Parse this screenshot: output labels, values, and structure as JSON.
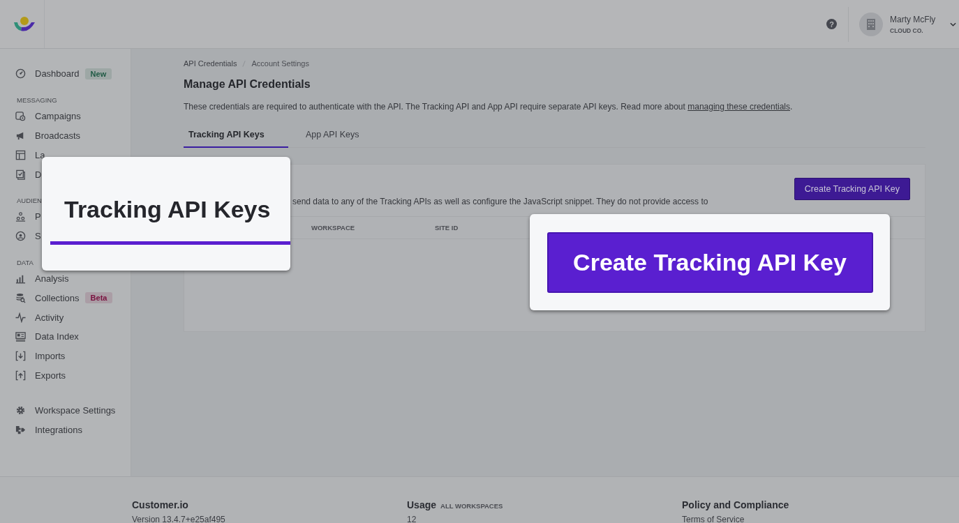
{
  "header": {
    "user_name": "Marty McFly",
    "company": "CLOUD CO.",
    "help": "?"
  },
  "sidebar": {
    "groups": [
      {
        "items": [
          {
            "label": "Dashboard",
            "badge": {
              "text": "New",
              "color": "#1f5a44"
            }
          }
        ]
      },
      {
        "heading": "MESSAGING",
        "items": [
          {
            "label": "Campaigns"
          },
          {
            "label": "Broadcasts"
          },
          {
            "label": "La"
          },
          {
            "label": "D"
          }
        ]
      },
      {
        "heading": "AUDIEN",
        "items": [
          {
            "label": "P"
          },
          {
            "label": "S"
          }
        ]
      },
      {
        "heading": "DATA",
        "items": [
          {
            "label": "Analysis"
          },
          {
            "label": "Collections",
            "badge": {
              "text": "Beta",
              "color": "#7a1240"
            }
          },
          {
            "label": "Activity"
          },
          {
            "label": "Data Index"
          },
          {
            "label": "Imports"
          },
          {
            "label": "Exports"
          }
        ]
      },
      {
        "items": [
          {
            "label": "Workspace Settings"
          },
          {
            "label": "Integrations"
          }
        ]
      }
    ]
  },
  "breadcrumb": [
    "API Credentials",
    "Account Settings"
  ],
  "title": "Manage API Credentials",
  "intro": {
    "text": "These credentials are required to authenticate with the API. The Tracking API and App API require separate API keys. Read more about ",
    "link": "managing these credentials",
    "after": "."
  },
  "tabs": [
    {
      "label": "Tracking API Keys",
      "selected": true
    },
    {
      "label": "App API Keys",
      "selected": false
    }
  ],
  "card": {
    "description": "send data to any of the Tracking APIs as well as configure the JavaScript snippet. They do not provide access to",
    "button": "Create Tracking API Key",
    "columns": [
      "WORKSPACE",
      "SITE ID"
    ]
  },
  "footer": [
    {
      "title": "Customer.io",
      "line": "Version 13.4.7+e25af495"
    },
    {
      "title": "Usage",
      "subtitle": "ALL WORKSPACES",
      "line": "12"
    },
    {
      "title": "Policy and Compliance",
      "line": "Terms of Service"
    }
  ],
  "callouts": [
    {
      "kind": "tab",
      "text": "Tracking API Keys"
    },
    {
      "kind": "button",
      "text": "Create Tracking API Key"
    }
  ]
}
